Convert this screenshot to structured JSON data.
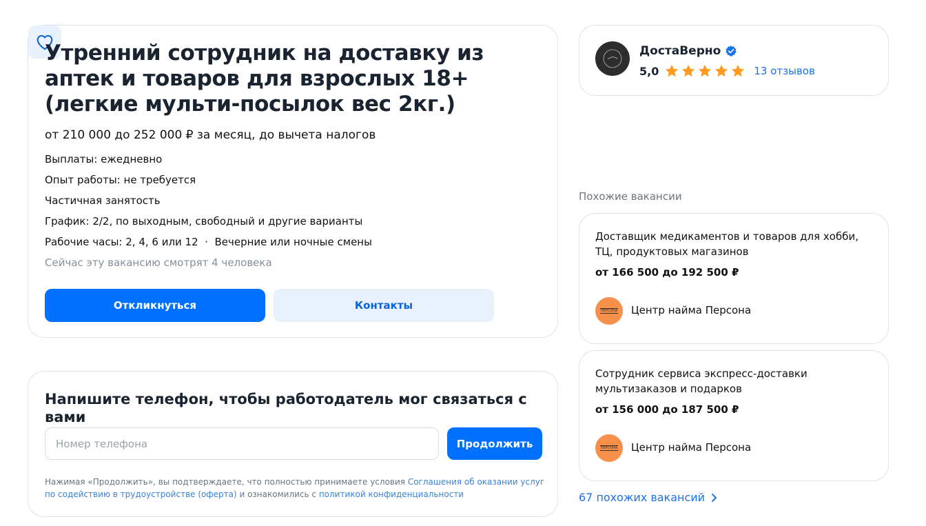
{
  "vacancy": {
    "title": "Утренний сотрудник на доставку из аптек и товаров для взрослых 18+ (легкие мульти-посылок вес 2кг.)",
    "salary": "от 210 000 до 252 000 ₽ за месяц, до вычета налогов",
    "details": [
      "Выплаты: ежедневно",
      "Опыт работы: не требуется",
      "Частичная занятость",
      "График: 2/2, по выходным, свободный и другие варианты",
      "Рабочие часы: 2, 4, 6 или 12  ·  Вечерние или ночные смены"
    ],
    "viewers": "Сейчас эту вакансию смотрят 4 человека",
    "respond_label": "Откликнуться",
    "contacts_label": "Контакты",
    "favorite_icon": "heart-icon"
  },
  "phone_form": {
    "title": "Напишите телефон, чтобы работодатель мог связаться с вами",
    "placeholder": "Номер телефона",
    "continue_label": "Продолжить",
    "legal_prefix": "Нажимая «Продолжить», вы подтверждаете, что полностью принимаете условия ",
    "legal_link1": "Соглашения об оказании услуг по содействию в трудоустройстве (оферта)",
    "legal_middle": " и ознакомились с ",
    "legal_link2": "политикой конфиденциальности"
  },
  "employer": {
    "name": "ДостаВерно",
    "verified_icon": "verified-badge-icon",
    "rating": "5,0",
    "stars": 5,
    "reviews": "13 отзывов"
  },
  "similar": {
    "heading": "Похожие вакансии",
    "items": [
      {
        "title": "Доставщик медикаментов и товаров для хобби, ТЦ, продуктовых магазинов",
        "salary": "от 166 500 до 192 500 ₽",
        "company": "Центр найма Персона",
        "logo_text": "ПЕРСОНА"
      },
      {
        "title": "Сотрудник сервиса экспресс-доставки мультизаказов и подарков",
        "salary": "от 156 000 до 187 500 ₽",
        "company": "Центр найма Персона",
        "logo_text": "ПЕРСОНА"
      }
    ],
    "more_label": "67 похожих вакансий"
  },
  "colors": {
    "primary": "#0070ff",
    "secondary_bg": "#e8f1fc",
    "link": "#1a73e8",
    "star": "#ff9a1f",
    "company_logo_bg": "#f7904a"
  }
}
